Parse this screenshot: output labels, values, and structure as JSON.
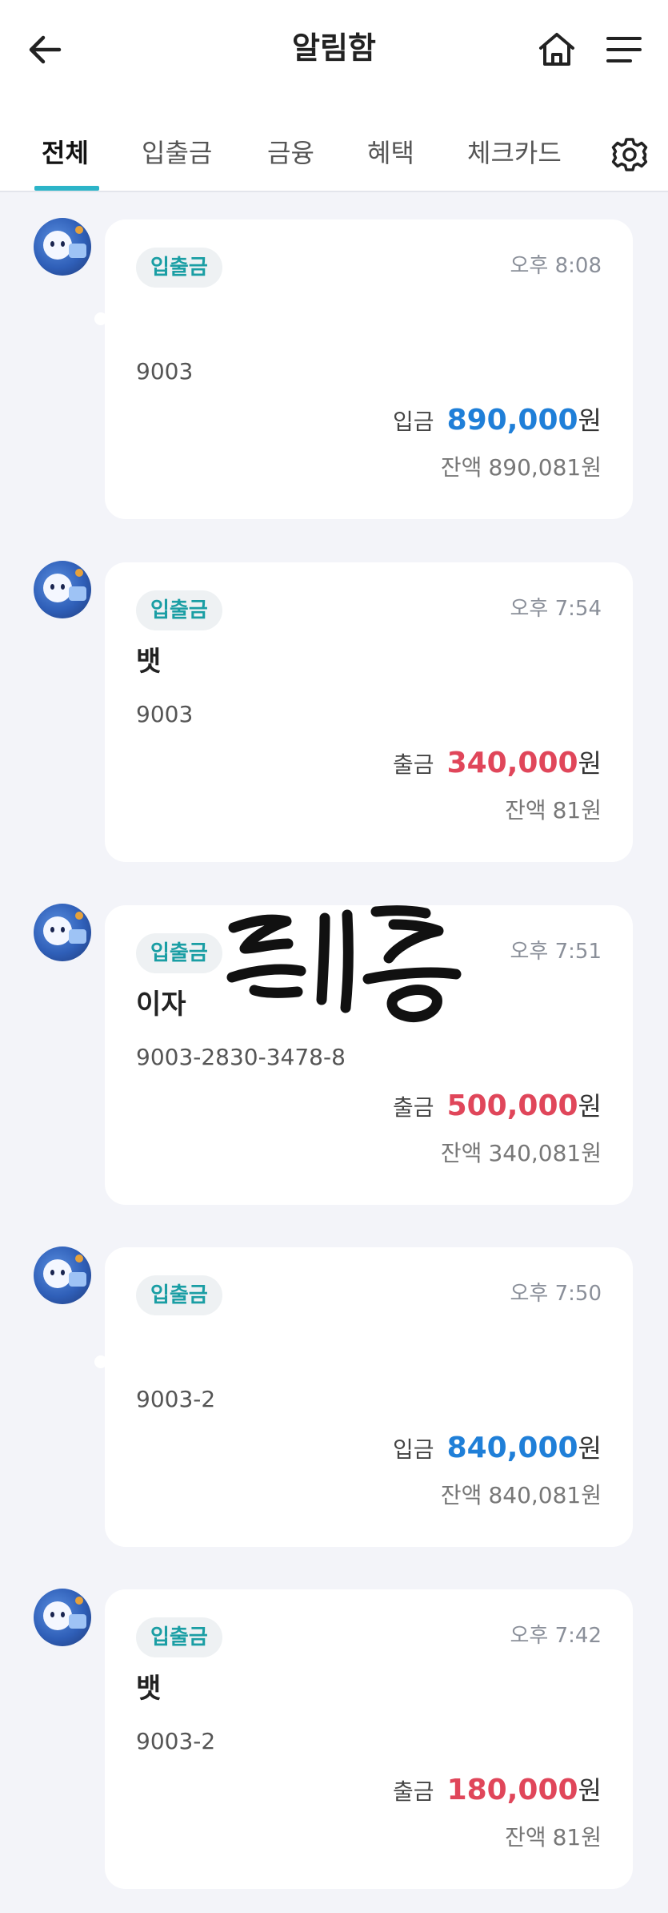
{
  "header": {
    "title": "알림함",
    "back_icon": "arrow-left-icon",
    "home_icon": "home-icon",
    "menu_icon": "hamburger-menu-icon"
  },
  "tabs": [
    {
      "label": "전체",
      "active": true
    },
    {
      "label": "입출금",
      "active": false
    },
    {
      "label": "금융",
      "active": false
    },
    {
      "label": "혜택",
      "active": false
    },
    {
      "label": "체크카드",
      "active": false
    }
  ],
  "settings_icon": "gear-icon",
  "colors": {
    "accent": "#2cb4c8",
    "deposit": "#1f7fd8",
    "withdraw": "#e0465a",
    "category_text": "#1a9ea4",
    "background": "#f3f4f9"
  },
  "notifications": [
    {
      "category": "입출금",
      "time": "오후 8:08",
      "memo": "",
      "account": "9003",
      "type": "입금",
      "amount": "890,000",
      "currency": "원",
      "balance_label": "잔액",
      "balance": "890,081원"
    },
    {
      "category": "입출금",
      "time": "오후 7:54",
      "memo": "뱃",
      "account": "9003",
      "type": "출금",
      "amount": "340,000",
      "currency": "원",
      "balance_label": "잔액",
      "balance": "81원"
    },
    {
      "category": "입출금",
      "time": "오후 7:51",
      "memo": "이자",
      "account": "9003-2830-3478-8",
      "type": "출금",
      "amount": "500,000",
      "currency": "원",
      "balance_label": "잔액",
      "balance": "340,081원"
    },
    {
      "category": "입출금",
      "time": "오후 7:50",
      "memo": "",
      "account": "9003-2",
      "type": "입금",
      "amount": "840,000",
      "currency": "원",
      "balance_label": "잔액",
      "balance": "840,081원"
    },
    {
      "category": "입출금",
      "time": "오후 7:42",
      "memo": "뱃",
      "account": "9003-2",
      "type": "출금",
      "amount": "180,000",
      "currency": "원",
      "balance_label": "잔액",
      "balance": "81원"
    }
  ]
}
